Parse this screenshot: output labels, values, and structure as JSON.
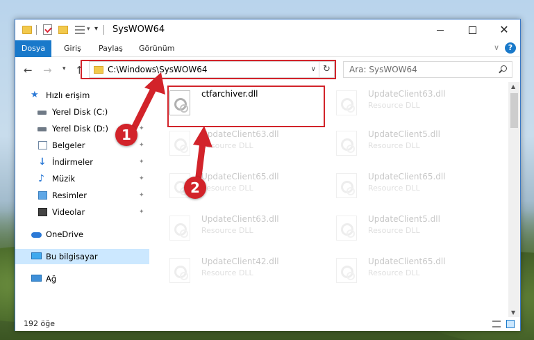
{
  "window": {
    "title": "SysWOW64",
    "minimize_label": "",
    "maximize_label": "",
    "close_label": "✕"
  },
  "ribbon": {
    "tabs": [
      "Dosya",
      "Giriş",
      "Paylaş",
      "Görünüm"
    ],
    "help": "?"
  },
  "nav": {
    "back": "←",
    "forward": "→",
    "recent": "▾",
    "up": "↑",
    "address": "C:\\Windows\\SysWOW64",
    "address_dropdown": "∨",
    "refresh": "↻",
    "search_placeholder": "Ara: SysWOW64"
  },
  "sidebar": {
    "items": [
      {
        "label": "Hızlı erişim",
        "icon": "quick-access-star-icon",
        "pinned": false
      },
      {
        "label": "Yerel Disk (C:)",
        "icon": "drive-icon",
        "pinned": true
      },
      {
        "label": "Yerel Disk (D:)",
        "icon": "drive-icon",
        "pinned": true
      },
      {
        "label": "Belgeler",
        "icon": "documents-icon",
        "pinned": true
      },
      {
        "label": "İndirmeler",
        "icon": "downloads-icon",
        "pinned": true
      },
      {
        "label": "Müzik",
        "icon": "music-icon",
        "pinned": true
      },
      {
        "label": "Resimler",
        "icon": "pictures-icon",
        "pinned": true
      },
      {
        "label": "Videolar",
        "icon": "videos-icon",
        "pinned": true
      },
      {
        "label": "OneDrive",
        "icon": "onedrive-cloud-icon",
        "pinned": false
      },
      {
        "label": "Bu bilgisayar",
        "icon": "this-pc-icon",
        "pinned": false,
        "selected": true
      },
      {
        "label": "Ağ",
        "icon": "network-icon",
        "pinned": false
      }
    ],
    "pin_glyph": "📌"
  },
  "files": [
    {
      "name": "ctfarchiver.dll",
      "type": "",
      "highlight": true
    },
    {
      "name": "UpdateClient63.dll",
      "type": "Resource DLL"
    },
    {
      "name": "UpdateClient63.dll",
      "type": "Resource DLL"
    },
    {
      "name": "UpdateClient5.dll",
      "type": "Resource DLL"
    },
    {
      "name": "UpdateClient65.dll",
      "type": "Resource DLL"
    },
    {
      "name": "UpdateClient65.dll",
      "type": "Resource DLL"
    },
    {
      "name": "UpdateClient63.dll",
      "type": "Resource DLL"
    },
    {
      "name": "UpdateClient5.dll",
      "type": "Resource DLL"
    },
    {
      "name": "UpdateClient42.dll",
      "type": "Resource DLL"
    },
    {
      "name": "UpdateClient65.dll",
      "type": "Resource DLL"
    }
  ],
  "status": {
    "item_count": "192 öğe"
  },
  "annotations": {
    "badge_1": "1",
    "badge_2": "2",
    "color": "#d2232a"
  },
  "colors": {
    "accent": "#1979ca",
    "selection": "#cce8ff"
  }
}
